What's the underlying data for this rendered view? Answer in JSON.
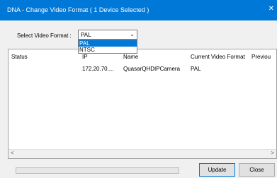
{
  "window": {
    "title": "DNA - Change Video Format ( 1 Device Selected )",
    "close_glyph": "✕"
  },
  "format": {
    "label": "Select Video Format :",
    "selected": "PAL",
    "options": [
      "PAL",
      "NTSC"
    ],
    "highlighted_option": "PAL"
  },
  "list": {
    "columns": [
      "Status",
      "IP",
      "Name",
      "Current Video Format",
      "Previou"
    ],
    "rows": [
      [
        "",
        "172.20.70....",
        "QuasarQHDIPCamera",
        "PAL",
        ""
      ]
    ]
  },
  "buttons": {
    "update": "Update",
    "close": "Close"
  },
  "progress": 0
}
